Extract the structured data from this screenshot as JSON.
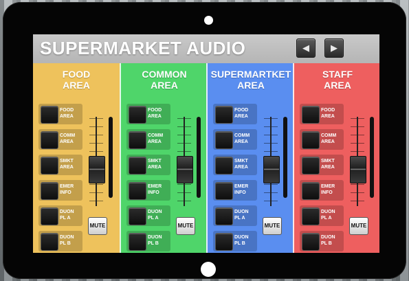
{
  "app": {
    "title": "SUPERMARKET AUDIO",
    "nav_prev_icon": "◀",
    "nav_next_icon": "▶"
  },
  "colors": {
    "food": "#eec25c",
    "common": "#4fd56a",
    "supermarket": "#5a8ef0",
    "staff": "#ee5f5f",
    "title_bar": "#bdbdbd"
  },
  "zones": [
    {
      "title_line1": "FOOD",
      "title_line2": "AREA",
      "mute_label": "MUTE",
      "fader_level": 0.38,
      "sources": [
        {
          "line1": "FOOD",
          "line2": "AREA"
        },
        {
          "line1": "COMM",
          "line2": "AREA"
        },
        {
          "line1": "SMKT",
          "line2": "AREA"
        },
        {
          "line1": "EMER",
          "line2": "INFO"
        },
        {
          "line1": "DUON",
          "line2": "PL A"
        },
        {
          "line1": "DUON",
          "line2": "PL B"
        }
      ]
    },
    {
      "title_line1": "COMMON",
      "title_line2": "AREA",
      "mute_label": "MUTE",
      "fader_level": 0.38,
      "sources": [
        {
          "line1": "FOOD",
          "line2": "AREA"
        },
        {
          "line1": "COMM",
          "line2": "AREA"
        },
        {
          "line1": "SMKT",
          "line2": "AREA"
        },
        {
          "line1": "EMER",
          "line2": "INFO"
        },
        {
          "line1": "DUON",
          "line2": "PL A"
        },
        {
          "line1": "DUON",
          "line2": "PL B"
        }
      ]
    },
    {
      "title_line1": "SUPERMARTKET",
      "title_line2": "AREA",
      "mute_label": "MUTE",
      "fader_level": 0.38,
      "sources": [
        {
          "line1": "FOOD",
          "line2": "AREA"
        },
        {
          "line1": "COMM",
          "line2": "AREA"
        },
        {
          "line1": "SMKT",
          "line2": "AREA"
        },
        {
          "line1": "EMER",
          "line2": "INFO"
        },
        {
          "line1": "DUON",
          "line2": "PL A"
        },
        {
          "line1": "DUON",
          "line2": "PL B"
        }
      ]
    },
    {
      "title_line1": "STAFF",
      "title_line2": "AREA",
      "mute_label": "MUTE",
      "fader_level": 0.38,
      "sources": [
        {
          "line1": "FOOD",
          "line2": "AREA"
        },
        {
          "line1": "COMM",
          "line2": "AREA"
        },
        {
          "line1": "SMKT",
          "line2": "AREA"
        },
        {
          "line1": "EMER",
          "line2": "INFO"
        },
        {
          "line1": "DUON",
          "line2": "PL A"
        },
        {
          "line1": "DUON",
          "line2": "PL B"
        }
      ]
    }
  ]
}
